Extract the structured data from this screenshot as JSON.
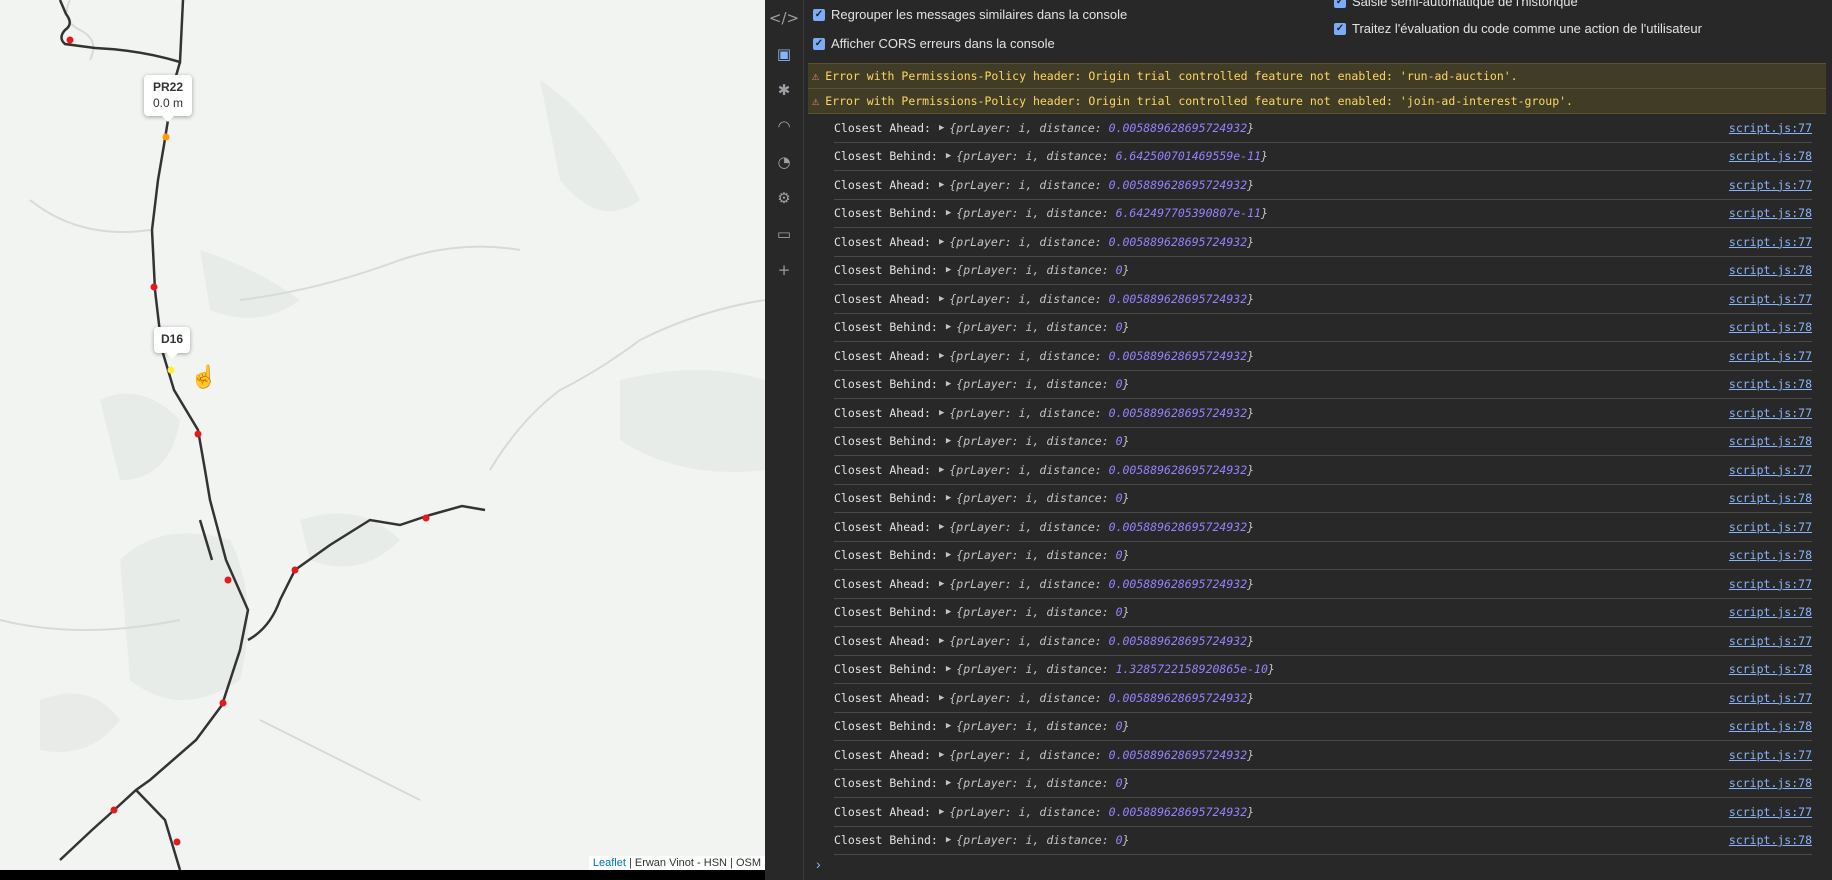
{
  "map": {
    "markers": [
      {
        "label": "PR22",
        "sub": "0.0 m"
      },
      {
        "label": "D16",
        "sub": ""
      }
    ],
    "attribution": {
      "link": "Leaflet",
      "rest": " | Erwan Vinot - HSN | OSM"
    },
    "colors": {
      "stop": "#e41a1c",
      "selected": "#ff9900",
      "hover": "#ffee33",
      "route": "#333333"
    }
  },
  "devtools": {
    "side_icons": [
      "code-icon",
      "console-icon",
      "bug-icon",
      "wifi-icon",
      "gauge-icon",
      "chip-icon",
      "window-icon",
      "plus-icon"
    ],
    "settings": [
      {
        "label": "Regrouper les messages similaires dans la console",
        "checked": true
      },
      {
        "label": "Afficher CORS erreurs dans la console",
        "checked": true
      },
      {
        "label": "Saisie semi-automatique de l'historique",
        "checked": true
      },
      {
        "label": "Traitez l'évaluation du code comme une action de l'utilisateur",
        "checked": true
      }
    ],
    "warnings": [
      "Error with Permissions-Policy header: Origin trial controlled feature not enabled: 'run-ad-auction'.",
      "Error with Permissions-Policy header: Origin trial controlled feature not enabled: 'join-ad-interest-group'."
    ],
    "logs": [
      {
        "label": "Closest Ahead:",
        "key1": "prLayer: ",
        "v1": "i",
        "key2": ", distance: ",
        "v2": "0.005889628695724932",
        "src": "script.js:77"
      },
      {
        "label": "Closest Behind:",
        "key1": "prLayer: ",
        "v1": "i",
        "key2": ", distance: ",
        "v2": "6.642500701469559e-11",
        "src": "script.js:78"
      },
      {
        "label": "Closest Ahead:",
        "key1": "prLayer: ",
        "v1": "i",
        "key2": ", distance: ",
        "v2": "0.005889628695724932",
        "src": "script.js:77"
      },
      {
        "label": "Closest Behind:",
        "key1": "prLayer: ",
        "v1": "i",
        "key2": ", distance: ",
        "v2": "6.642497705390807e-11",
        "src": "script.js:78"
      },
      {
        "label": "Closest Ahead:",
        "key1": "prLayer: ",
        "v1": "i",
        "key2": ", distance: ",
        "v2": "0.005889628695724932",
        "src": "script.js:77"
      },
      {
        "label": "Closest Behind:",
        "key1": "prLayer: ",
        "v1": "i",
        "key2": ", distance: ",
        "v2": "0",
        "src": "script.js:78"
      },
      {
        "label": "Closest Ahead:",
        "key1": "prLayer: ",
        "v1": "i",
        "key2": ", distance: ",
        "v2": "0.005889628695724932",
        "src": "script.js:77"
      },
      {
        "label": "Closest Behind:",
        "key1": "prLayer: ",
        "v1": "i",
        "key2": ", distance: ",
        "v2": "0",
        "src": "script.js:78"
      },
      {
        "label": "Closest Ahead:",
        "key1": "prLayer: ",
        "v1": "i",
        "key2": ", distance: ",
        "v2": "0.005889628695724932",
        "src": "script.js:77"
      },
      {
        "label": "Closest Behind:",
        "key1": "prLayer: ",
        "v1": "i",
        "key2": ", distance: ",
        "v2": "0",
        "src": "script.js:78"
      },
      {
        "label": "Closest Ahead:",
        "key1": "prLayer: ",
        "v1": "i",
        "key2": ", distance: ",
        "v2": "0.005889628695724932",
        "src": "script.js:77"
      },
      {
        "label": "Closest Behind:",
        "key1": "prLayer: ",
        "v1": "i",
        "key2": ", distance: ",
        "v2": "0",
        "src": "script.js:78"
      },
      {
        "label": "Closest Ahead:",
        "key1": "prLayer: ",
        "v1": "i",
        "key2": ", distance: ",
        "v2": "0.005889628695724932",
        "src": "script.js:77"
      },
      {
        "label": "Closest Behind:",
        "key1": "prLayer: ",
        "v1": "i",
        "key2": ", distance: ",
        "v2": "0",
        "src": "script.js:78"
      },
      {
        "label": "Closest Ahead:",
        "key1": "prLayer: ",
        "v1": "i",
        "key2": ", distance: ",
        "v2": "0.005889628695724932",
        "src": "script.js:77"
      },
      {
        "label": "Closest Behind:",
        "key1": "prLayer: ",
        "v1": "i",
        "key2": ", distance: ",
        "v2": "0",
        "src": "script.js:78"
      },
      {
        "label": "Closest Ahead:",
        "key1": "prLayer: ",
        "v1": "i",
        "key2": ", distance: ",
        "v2": "0.005889628695724932",
        "src": "script.js:77"
      },
      {
        "label": "Closest Behind:",
        "key1": "prLayer: ",
        "v1": "i",
        "key2": ", distance: ",
        "v2": "0",
        "src": "script.js:78"
      },
      {
        "label": "Closest Ahead:",
        "key1": "prLayer: ",
        "v1": "i",
        "key2": ", distance: ",
        "v2": "0.005889628695724932",
        "src": "script.js:77"
      },
      {
        "label": "Closest Behind:",
        "key1": "prLayer: ",
        "v1": "i",
        "key2": ", distance: ",
        "v2": "1.3285722158920865e-10",
        "src": "script.js:78"
      },
      {
        "label": "Closest Ahead:",
        "key1": "prLayer: ",
        "v1": "i",
        "key2": ", distance: ",
        "v2": "0.005889628695724932",
        "src": "script.js:77"
      },
      {
        "label": "Closest Behind:",
        "key1": "prLayer: ",
        "v1": "i",
        "key2": ", distance: ",
        "v2": "0",
        "src": "script.js:78"
      },
      {
        "label": "Closest Ahead:",
        "key1": "prLayer: ",
        "v1": "i",
        "key2": ", distance: ",
        "v2": "0.005889628695724932",
        "src": "script.js:77"
      },
      {
        "label": "Closest Behind:",
        "key1": "prLayer: ",
        "v1": "i",
        "key2": ", distance: ",
        "v2": "0",
        "src": "script.js:78"
      },
      {
        "label": "Closest Ahead:",
        "key1": "prLayer: ",
        "v1": "i",
        "key2": ", distance: ",
        "v2": "0.005889628695724932",
        "src": "script.js:77"
      },
      {
        "label": "Closest Behind:",
        "key1": "prLayer: ",
        "v1": "i",
        "key2": ", distance: ",
        "v2": "0",
        "src": "script.js:78"
      }
    ],
    "prompt": "›"
  }
}
